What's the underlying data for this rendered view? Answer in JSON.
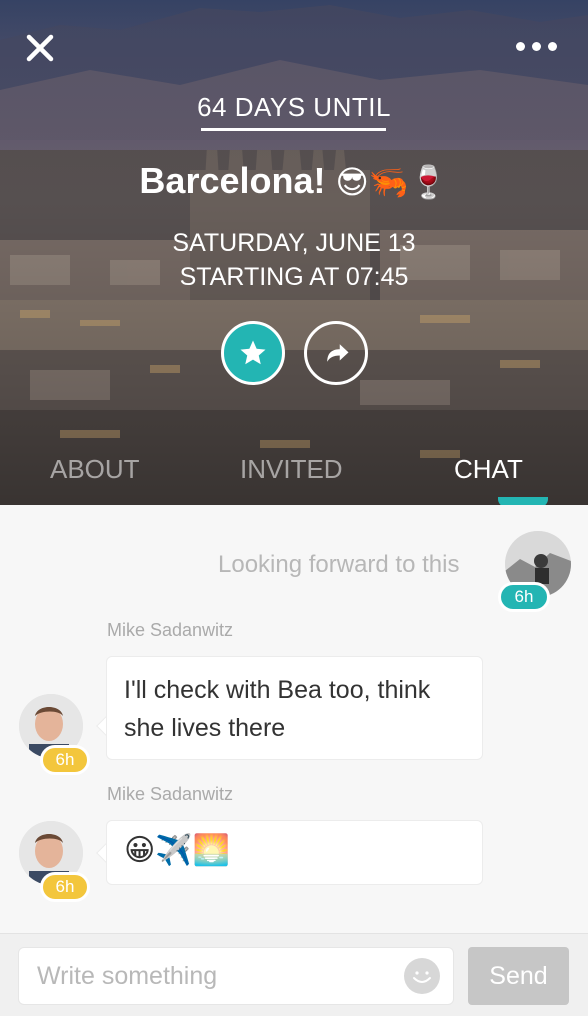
{
  "header": {
    "countdown": "64 DAYS UNTIL",
    "title": "Barcelona!",
    "title_emojis": "😎🦐🍷",
    "date": "SATURDAY, JUNE 13",
    "time": "STARTING AT 07:45"
  },
  "tabs": [
    {
      "label": "ABOUT",
      "active": false
    },
    {
      "label": "INVITED",
      "active": false
    },
    {
      "label": "CHAT",
      "active": true
    }
  ],
  "chat": {
    "own_message": {
      "text": "Looking forward to this",
      "time": "6h"
    },
    "messages": [
      {
        "sender": "Mike Sadanwitz",
        "text": "I'll check with Bea too, think she lives there",
        "time": "6h"
      },
      {
        "sender": "Mike Sadanwitz",
        "text": "😀✈️🌅",
        "time": "6h"
      }
    ]
  },
  "composer": {
    "placeholder": "Write something",
    "send_label": "Send"
  },
  "colors": {
    "accent": "#23b5b3",
    "time_badge": "#f3c63c",
    "send_disabled": "#c6c6c6"
  },
  "icons": [
    "close-icon",
    "more-icon",
    "star-icon",
    "share-icon",
    "smiley-icon"
  ]
}
